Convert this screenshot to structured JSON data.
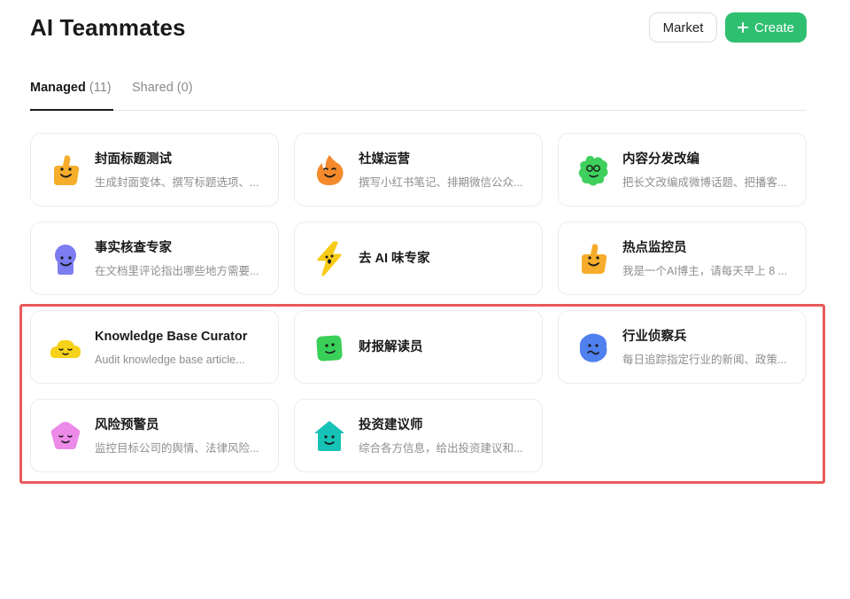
{
  "header": {
    "title": "AI Teammates",
    "market_label": "Market",
    "create_label": "Create"
  },
  "tabs": [
    {
      "label": "Managed",
      "count": "(11)"
    },
    {
      "label": "Shared",
      "count": "(0)"
    }
  ],
  "colors": {
    "accent": "#2fbf71",
    "highlight": "#e85a5a"
  },
  "cards": [
    {
      "name": "封面标题测试",
      "desc": "生成封面变体、撰写标题选项、...",
      "icon": "thumbs-up-mascot-icon",
      "color": "#f6ad2b"
    },
    {
      "name": "社媒运营",
      "desc": "撰写小红书笔记、排期微信公众...",
      "icon": "flame-mascot-icon",
      "color": "#f58a2c"
    },
    {
      "name": "内容分发改编",
      "desc": "把长文改编成微博话题、把播客...",
      "icon": "puzzle-mascot-icon",
      "color": "#3fcf5c"
    },
    {
      "name": "事实核查专家",
      "desc": "在文档里评论指出哪些地方需要...",
      "icon": "person-mascot-icon",
      "color": "#7b7df0"
    },
    {
      "name": "去 AI 味专家",
      "desc": "",
      "icon": "lightning-mascot-icon",
      "color": "#f7cb16"
    },
    {
      "name": "热点监控员",
      "desc": "我是一个AI博主，请每天早上 8 ...",
      "icon": "thumbs-up-mascot-icon",
      "color": "#f6ad2b"
    },
    {
      "name": "Knowledge Base Curator",
      "desc": "Audit knowledge base article...",
      "icon": "cloud-mascot-icon",
      "color": "#f7d21a"
    },
    {
      "name": "财报解读员",
      "desc": "",
      "icon": "square-mascot-icon",
      "color": "#39cf58"
    },
    {
      "name": "行业侦察兵",
      "desc": "每日追踪指定行业的新闻、政策...",
      "icon": "blob-mascot-icon",
      "color": "#4f80ee"
    },
    {
      "name": "风险预警员",
      "desc": "监控目标公司的舆情、法律风险...",
      "icon": "pentagon-mascot-icon",
      "color": "#ec8ae8"
    },
    {
      "name": "投资建议师",
      "desc": "综合各方信息，给出投资建议和...",
      "icon": "house-mascot-icon",
      "color": "#16c2b5"
    }
  ]
}
